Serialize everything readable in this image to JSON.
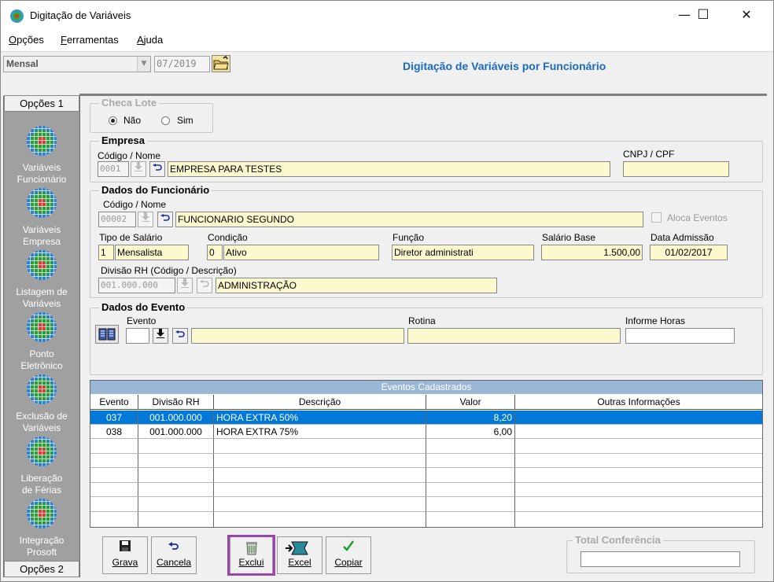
{
  "window": {
    "title": "Digitação de Variáveis",
    "min": "—",
    "max": "☐",
    "close": "✕"
  },
  "menu": [
    {
      "first": "O",
      "rest": "pções"
    },
    {
      "first": "F",
      "rest": "erramentas"
    },
    {
      "first": "A",
      "rest": "juda"
    }
  ],
  "toolbar": {
    "period": "Mensal",
    "period_arrow": "▼",
    "date": "07/2019",
    "heading": "Digitação de Variáveis por Funcionário"
  },
  "sidebar": {
    "tab_top": "Opções 1",
    "tab_bottom": "Opções 2",
    "items": [
      {
        "line1": "Variáveis",
        "line2": "Funcionário"
      },
      {
        "line1": "Variáveis",
        "line2": "Empresa"
      },
      {
        "line1": "Listagem de",
        "line2": "Variáveis"
      },
      {
        "line1": "Ponto",
        "line2": "Eletrônico"
      },
      {
        "line1": "Exclusão de",
        "line2": "Variáveis"
      },
      {
        "line1": "Liberação",
        "line2": "de Férias"
      },
      {
        "line1": "Integração",
        "line2": "Prosoft"
      }
    ]
  },
  "checa_lote": {
    "title": "Checa Lote",
    "opt_nao": "Não",
    "opt_sim": "Sim",
    "selected": "Não"
  },
  "empresa": {
    "title": "Empresa",
    "label_code": "Código / Nome",
    "code": "0001",
    "name": "EMPRESA PARA TESTES",
    "label_cnpj": "CNPJ / CPF",
    "cnpj": ""
  },
  "funcionario": {
    "title": "Dados do Funcionário",
    "label_code": "Código / Nome",
    "code": "00002",
    "name": "FUNCIONARIO SEGUNDO",
    "aloca_eventos": "Aloca Eventos",
    "label_tipo": "Tipo de Salário",
    "tipo_code": "1",
    "tipo_desc": "Mensalista",
    "label_cond": "Condição",
    "cond_code": "0",
    "cond_desc": "Ativo",
    "label_funcao": "Função",
    "funcao": "Diretor administrati",
    "label_salario": "Salário Base",
    "salario": "1.500,00",
    "label_admissao": "Data Admissão",
    "admissao": "01/02/2017",
    "label_divisao": "Divisão RH (Código / Descrição)",
    "divisao_code": "001.000.000",
    "divisao_desc": "ADMINISTRAÇÃO"
  },
  "evento": {
    "title": "Dados do Evento",
    "label_evento": "Evento",
    "label_rotina": "Rotina",
    "label_horas": "Informe Horas"
  },
  "grid": {
    "caption": "Eventos Cadastrados",
    "headers": [
      "Evento",
      "Divisão RH",
      "Descrição",
      "Valor",
      "Outras Informações"
    ],
    "rows": [
      [
        "037",
        "001.000.000",
        "HORA EXTRA 50%",
        "8,20",
        ""
      ],
      [
        "038",
        "001.000.000",
        "HORA EXTRA 75%",
        "6,00",
        ""
      ]
    ]
  },
  "buttons": {
    "grava": "Grava",
    "cancela": "Cancela",
    "exclui": "Exclui",
    "excel": "Excel",
    "copiar": "Copiar"
  },
  "total": {
    "title": "Total Conferência",
    "value": ""
  },
  "colors": {
    "heading": "#1b6ac1",
    "selection": "#0078d7",
    "field_bg": "#fdf9cf",
    "highlight": "#9b46ac"
  }
}
